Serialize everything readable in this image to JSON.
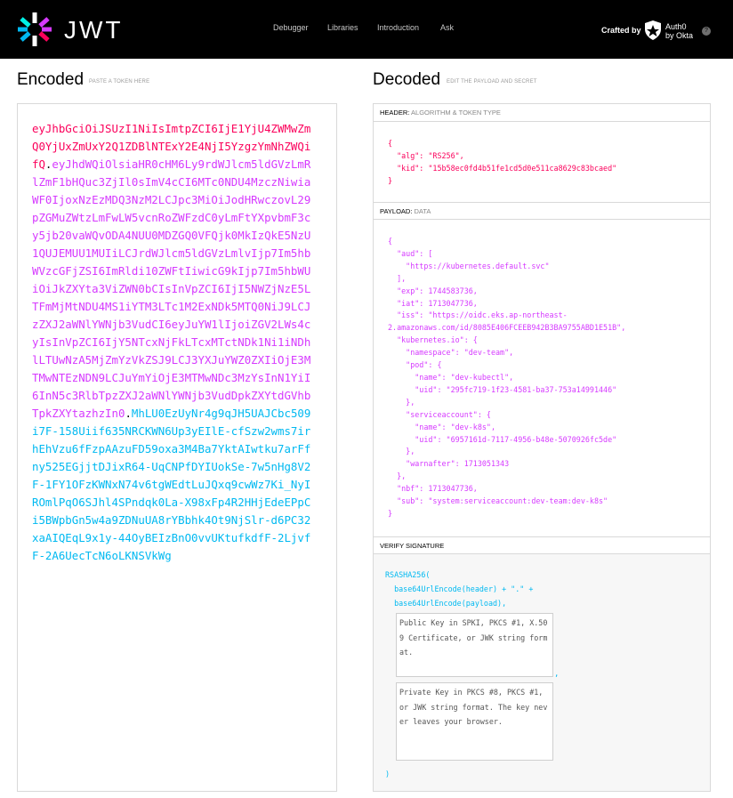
{
  "nav": {
    "logo_text": "JWT",
    "links": [
      "Debugger",
      "Libraries",
      "Introduction",
      "Ask"
    ],
    "crafted_by": "Crafted by",
    "auth0_line1": "Auth0",
    "auth0_line2": "by Okta",
    "info_glyph": "?"
  },
  "encoded": {
    "title": "Encoded",
    "hint": "PASTE A TOKEN HERE",
    "token_header": "eyJhbGciOiJSUzI1NiIsImtpZCI6IjE1YjU4ZWMwZmQ0YjUxZmUxY2Q1ZDBlNTExY2E4NjI5YzgzYmNhZWQifQ",
    "token_payload": "eyJhdWQiOlsiaHR0cHM6Ly9rdWJlcm5ldGVzLmRlZmF1bHQuc3ZjIl0sImV4cCI6MTc0NDU4MzczNiwiaWF0IjoxNzEzMDQ3NzM2LCJpc3MiOiJodHRwczovL29pZGMuZWtzLmFwLW5vcnRoZWFzdC0yLmFtYXpvbmF3cy5jb20vaWQvODA4NUU0MDZGQ0VFQjk0MkIzQkE5NzU1QUJEMUU1MUIiLCJrdWJlcm5ldGVzLmlvIjp7Im5hbWVzcGFjZSI6ImRldi10ZWFtIiwicG9kIjp7Im5hbWUiOiJkZXYta3ViZWN0bCIsInVpZCI6IjI5NWZjNzE5LTFmMjMtNDU4MS1iYTM3LTc1M2ExNDk5MTQ0NiJ9LCJzZXJ2aWNlYWNjb3VudCI6eyJuYW1lIjoiZGV2LWs4cyIsInVpZCI6IjY5NTcxNjFkLTcxMTctNDk1Ni1iNDhlLTUwNzA5MjZmYzVkZSJ9LCJ3YXJuYWZ0ZXIiOjE3MTMwNTEzNDN9LCJuYmYiOjE3MTMwNDc3MzYsInN1YiI6InN5c3RlbTpzZXJ2aWNlYWNjb3VudDpkZXYtdGVhbTpkZXYtazhzIn0",
    "token_signature": "MhLU0EzUyNr4g9qJH5UAJCbc509i7F-158Uiif635NRCKWN6Up3yEIlE-cfSzw2wms7irhEhVzu6fFzpAAzuFD59oxa3M4Ba7YktAIwtku7arFfny525EGjjtDJixR64-UqCNPfDYIUokSe-7w5nHg8V2F-1FY1OFzKWNxN74v6tgWEdtLuJQxq9cwWz7Ki_NyIROmlPqO6SJhl4SPndqk0La-X98xFp4R2HHjEdeEPpCi5BWpbGn5w4a9ZDNuUA8rYBbhk4Ot9NjSlr-d6PC32xaAIQEqL9x1y-44OyBEIzBnO0vvUKtufkdfF-2LjvfF-2A6UecTcN6oLKNSVkWg"
  },
  "decoded": {
    "title": "Decoded",
    "hint": "EDIT THE PAYLOAD AND SECRET",
    "header_label": "HEADER:",
    "header_sub": "ALGORITHM & TOKEN TYPE",
    "payload_label": "PAYLOAD:",
    "payload_sub": "DATA",
    "verify_label": "VERIFY SIGNATURE",
    "header_json": "{\n  \"alg\": \"RS256\",\n  \"kid\": \"15b58ec0fd4b51fe1cd5d0e511ca8629c83bcaed\"\n}",
    "payload_json": "{\n  \"aud\": [\n    \"https://kubernetes.default.svc\"\n  ],\n  \"exp\": 1744583736,\n  \"iat\": 1713047736,\n  \"iss\": \"https://oidc.eks.ap-northeast-\n2.amazonaws.com/id/8085E406FCEEB942B3BA9755ABD1E51B\",\n  \"kubernetes.io\": {\n    \"namespace\": \"dev-team\",\n    \"pod\": {\n      \"name\": \"dev-kubectl\",\n      \"uid\": \"295fc719-1f23-4581-ba37-753a14991446\"\n    },\n    \"serviceaccount\": {\n      \"name\": \"dev-k8s\",\n      \"uid\": \"6957161d-7117-4956-b48e-5070926fc5de\"\n    },\n    \"warnafter\": 1713051343\n  },\n  \"nbf\": 1713047736,\n  \"sub\": \"system:serviceaccount:dev-team:dev-k8s\"\n}",
    "sig_line1": "RSASHA256(",
    "sig_line2": "  base64UrlEncode(header) + \".\" +",
    "sig_line3": "  base64UrlEncode(payload),",
    "public_key_placeholder": "Public Key in SPKI, PKCS #1, X.509 Certificate, or JWK string format.",
    "private_key_placeholder": "Private Key in PKCS #8, PKCS #1, or JWK string format. The key never leaves your browser.",
    "sig_comma": ",",
    "sig_close": ")"
  },
  "colors": {
    "header": "#fb015b",
    "payload": "#d63aff",
    "signature": "#00b9f1"
  }
}
